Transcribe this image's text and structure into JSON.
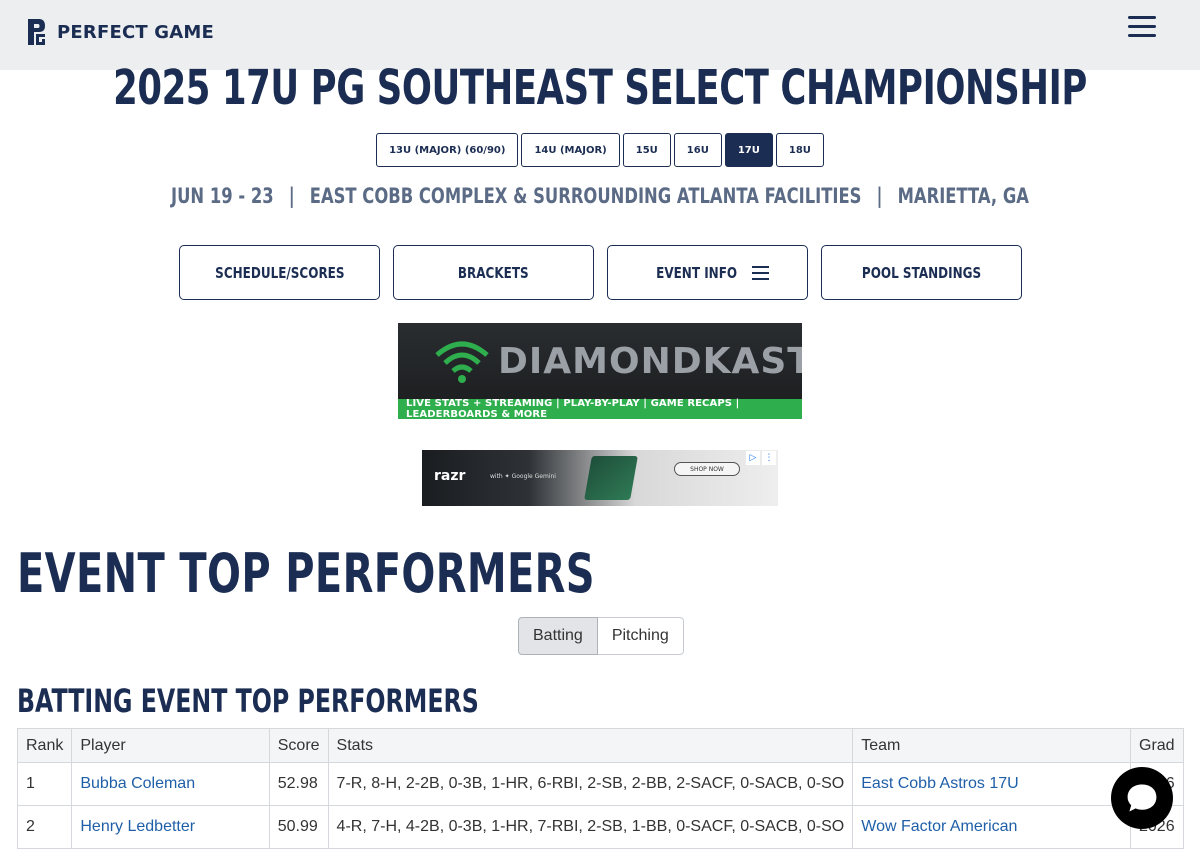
{
  "header": {
    "logo_text": "PERFECT GAME",
    "menu_icon": "hamburger-menu-icon"
  },
  "event": {
    "title": "2025 17U PG SOUTHEAST SELECT CHAMPIONSHIP",
    "age_tabs": [
      {
        "label": "13U (MAJOR) (60/90)",
        "active": false
      },
      {
        "label": "14U (MAJOR)",
        "active": false
      },
      {
        "label": "15U",
        "active": false
      },
      {
        "label": "16U",
        "active": false
      },
      {
        "label": "17U",
        "active": true
      },
      {
        "label": "18U",
        "active": false
      }
    ],
    "dates": "JUN 19 - 23",
    "venue": "EAST COBB COMPLEX & SURROUNDING ATLANTA FACILITIES",
    "location": "MARIETTA, GA",
    "separator": "|"
  },
  "nav": {
    "schedule": "SCHEDULE/SCORES",
    "brackets": "BRACKETS",
    "event_info": "EVENT INFO",
    "pool_standings": "POOL STANDINGS"
  },
  "ads": {
    "diamondkast_brand": "DIAMONDKAST",
    "diamondkast_tagline": "LIVE STATS + STREAMING | PLAY-BY-PLAY | GAME RECAPS | LEADERBOARDS & MORE",
    "razr_brand": "razr",
    "razr_partner": "with ✦ Google Gemini",
    "razr_cta": "SHOP NOW"
  },
  "performers": {
    "title": "EVENT TOP PERFORMERS",
    "toggle": {
      "batting": "Batting",
      "pitching": "Pitching",
      "active": "batting"
    },
    "batting_title": "BATTING EVENT TOP PERFORMERS",
    "columns": {
      "rank": "Rank",
      "player": "Player",
      "score": "Score",
      "stats": "Stats",
      "team": "Team",
      "grad": "Grad"
    },
    "rows": [
      {
        "rank": "1",
        "player": "Bubba Coleman",
        "score": "52.98",
        "stats": "7-R, 8-H, 2-2B, 0-3B, 1-HR, 6-RBI, 2-SB, 2-BB, 2-SACF, 0-SACB, 0-SO",
        "team": "East Cobb Astros 17U",
        "grad": "2026"
      },
      {
        "rank": "2",
        "player": "Henry Ledbetter",
        "score": "50.99",
        "stats": "4-R, 7-H, 4-2B, 0-3B, 1-HR, 7-RBI, 2-SB, 1-BB, 0-SACF, 0-SACB, 0-SO",
        "team": "Wow Factor American",
        "grad": "2026"
      }
    ]
  },
  "colors": {
    "navy": "#1b2d52",
    "link": "#1f5fa8",
    "ad_green": "#2fae4e"
  }
}
